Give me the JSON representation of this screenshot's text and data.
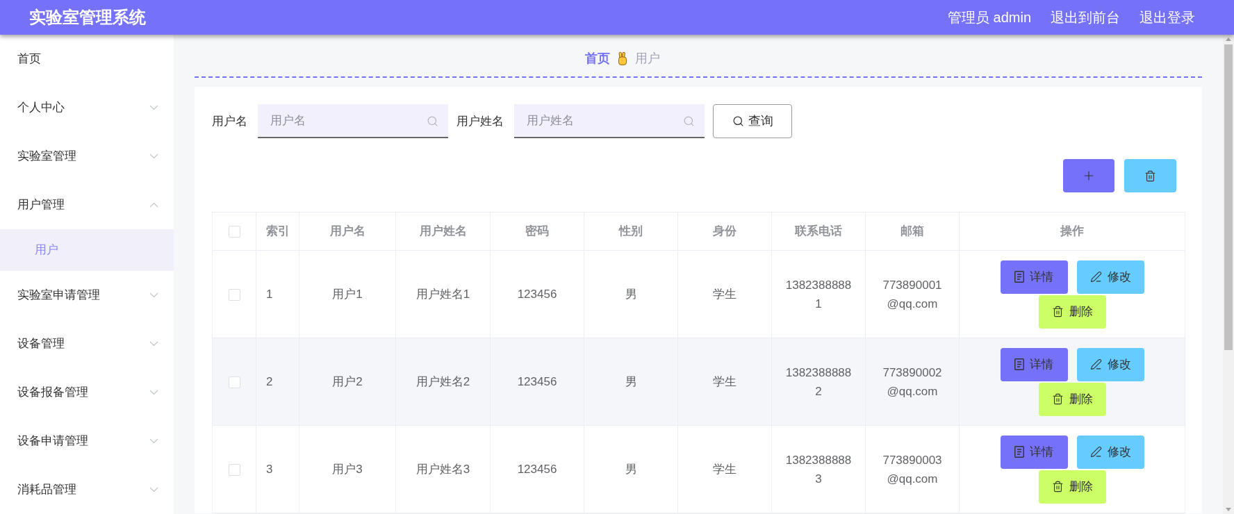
{
  "header": {
    "title": "实验室管理系统",
    "user": "管理员 admin",
    "links": [
      "退出到前台",
      "退出登录"
    ]
  },
  "sidebar": {
    "items": [
      {
        "kind": "item",
        "label": "首页",
        "selected": false
      },
      {
        "kind": "submenu",
        "label": "个人中心",
        "expanded": false
      },
      {
        "kind": "submenu",
        "label": "实验室管理",
        "expanded": false
      },
      {
        "kind": "submenu",
        "label": "用户管理",
        "expanded": true,
        "children": [
          {
            "label": "用户",
            "selected": true
          }
        ]
      },
      {
        "kind": "submenu",
        "label": "实验室申请管理",
        "expanded": false
      },
      {
        "kind": "submenu",
        "label": "设备管理",
        "expanded": false
      },
      {
        "kind": "submenu",
        "label": "设备报备管理",
        "expanded": false
      },
      {
        "kind": "submenu",
        "label": "设备申请管理",
        "expanded": false
      },
      {
        "kind": "submenu",
        "label": "消耗品管理",
        "expanded": false
      }
    ]
  },
  "breadcrumb": {
    "items": [
      "首页",
      "用户"
    ]
  },
  "search": {
    "fields": [
      {
        "label": "用户名",
        "placeholder": "用户名"
      },
      {
        "label": "用户姓名",
        "placeholder": "用户姓名"
      }
    ],
    "button": "查询"
  },
  "toolbar": {
    "buttons": [
      {
        "kind": "add"
      },
      {
        "kind": "delete"
      }
    ]
  },
  "table": {
    "select_all": {
      "checked": false
    },
    "columns": [
      "索引",
      "用户名",
      "用户姓名",
      "密码",
      "性别",
      "身份",
      "联系电话",
      "邮箱",
      "操作"
    ],
    "rows": [
      {
        "checked": false,
        "cells": [
          "1",
          "用户1",
          "用户姓名1",
          "123456",
          "男",
          "学生",
          "13823888881",
          "773890001@qq.com"
        ],
        "actions": [
          {
            "kind": "detail",
            "label": "详情"
          },
          {
            "kind": "edit",
            "label": "修改"
          },
          {
            "kind": "delete",
            "label": "删除"
          }
        ]
      },
      {
        "checked": false,
        "cells": [
          "2",
          "用户2",
          "用户姓名2",
          "123456",
          "男",
          "学生",
          "13823888882",
          "773890002@qq.com"
        ],
        "actions": [
          {
            "kind": "detail",
            "label": "详情"
          },
          {
            "kind": "edit",
            "label": "修改"
          },
          {
            "kind": "delete",
            "label": "删除"
          }
        ]
      },
      {
        "checked": false,
        "cells": [
          "3",
          "用户3",
          "用户姓名3",
          "123456",
          "男",
          "学生",
          "13823888883",
          "773890003@qq.com"
        ],
        "actions": [
          {
            "kind": "detail",
            "label": "详情"
          },
          {
            "kind": "edit",
            "label": "修改"
          },
          {
            "kind": "delete",
            "label": "删除"
          }
        ]
      }
    ]
  }
}
